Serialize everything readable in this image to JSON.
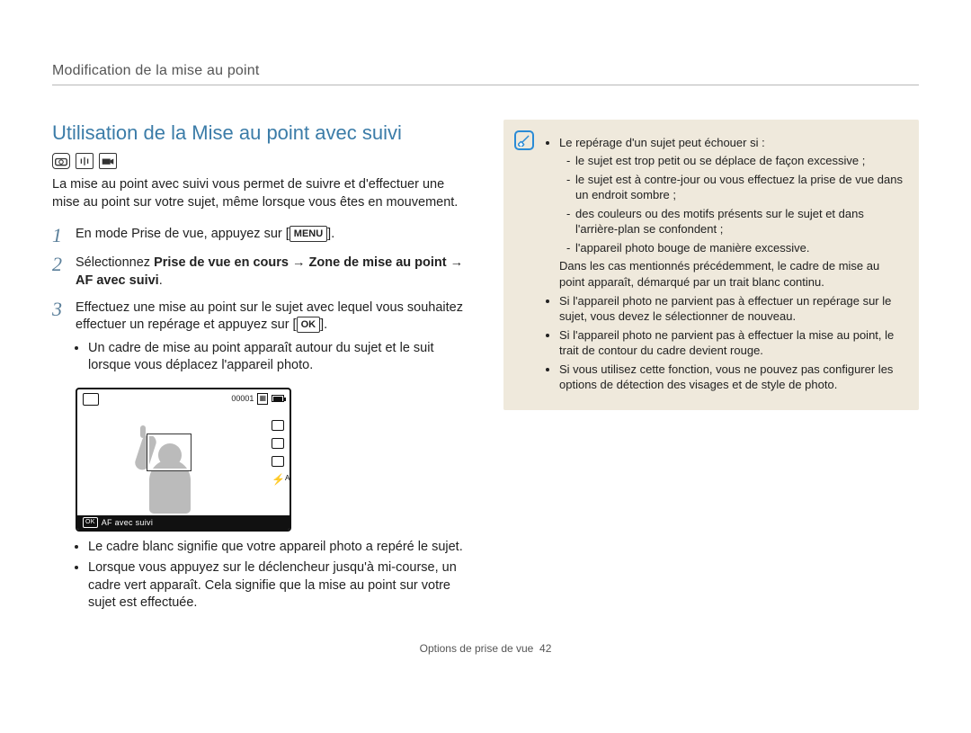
{
  "header": {
    "section_title": "Modification de la mise au point"
  },
  "heading": "Utilisation de la Mise au point avec suivi",
  "intro": "La mise au point avec suivi vous permet de suivre et d'effectuer une mise au point sur votre sujet, même lorsque vous êtes en mouvement.",
  "mode_icons": [
    "program-mode-icon",
    "dis-mode-icon",
    "movie-mode-icon"
  ],
  "steps": {
    "s1": {
      "num": "1",
      "pre": "En mode Prise de vue, appuyez sur [",
      "key": "MENU",
      "post": "]."
    },
    "s2": {
      "num": "2",
      "pre": "Sélectionnez ",
      "bold1": "Prise de vue en cours",
      "arrow1": " → ",
      "bold2": "Zone de mise au point",
      "arrow2": " → ",
      "bold3": "AF avec suivi",
      "post": "."
    },
    "s3": {
      "num": "3",
      "pre": "Effectuez une mise au point sur le sujet avec lequel vous souhaitez effectuer un repérage et appuyez sur [",
      "key": "OK",
      "post": "].",
      "sub1": "Un cadre de mise au point apparaît autour du sujet et le suit lorsque vous déplacez l'appareil photo."
    }
  },
  "lcd": {
    "counter": "00001",
    "caption": "AF avec suivi",
    "ok": "OK"
  },
  "after_bullets": {
    "b1": "Le cadre blanc signifie que votre appareil photo a repéré le sujet.",
    "b2": "Lorsque vous appuyez sur le déclencheur jusqu'à mi-course, un cadre vert apparaît. Cela signifie que la mise au point sur votre sujet est effectuée."
  },
  "tip": {
    "lead": "Le repérage d'un sujet peut échouer si :",
    "fail": {
      "a": "le sujet est trop petit ou se déplace de façon excessive ;",
      "b": "le sujet est à contre-jour ou vous effectuez la prise de vue dans un endroit sombre ;",
      "c": "des couleurs ou des motifs présents sur le sujet et dans l'arrière-plan se confondent ;",
      "d": "l'appareil photo bouge de manière excessive."
    },
    "follow": "Dans les cas mentionnés précédemment, le cadre de mise au point apparaît, démarqué par un trait blanc continu.",
    "p2": "Si l'appareil photo ne parvient pas à effectuer un repérage sur le sujet, vous devez le sélectionner de nouveau.",
    "p3": "Si l'appareil photo ne parvient pas à effectuer la mise au point, le trait de contour du cadre devient rouge.",
    "p4": "Si vous utilisez cette fonction, vous ne pouvez pas configurer les options de détection des visages et de style de photo."
  },
  "footer": {
    "label": "Options de prise de vue",
    "page": "42"
  }
}
